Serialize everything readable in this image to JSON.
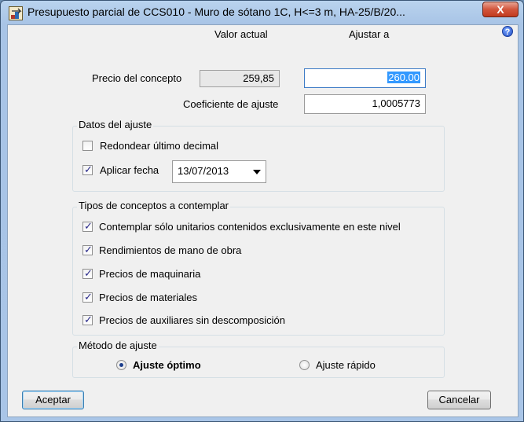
{
  "window": {
    "title": "Presupuesto parcial de CCS010 - Muro de sótano 1C, H<=3 m, HA-25/B/20...",
    "close_label": "X"
  },
  "prices": {
    "header_current": "Valor actual",
    "header_adjust": "Ajustar a",
    "concept_price_label": "Precio del concepto",
    "current_value": "259,85",
    "adjust_value": "260.00",
    "coefficient_label": "Coeficiente de ajuste",
    "coefficient_value": "1,0005773"
  },
  "adjust_data": {
    "legend": "Datos del ajuste",
    "round_label": "Redondear último decimal",
    "round_checked": false,
    "apply_date_label": "Aplicar fecha",
    "apply_date_checked": true,
    "date_value": "13/07/2013"
  },
  "concept_types": {
    "legend": "Tipos de conceptos a contemplar",
    "items": [
      {
        "label": "Contemplar sólo unitarios contenidos exclusivamente en este nivel",
        "checked": true
      },
      {
        "label": "Rendimientos de mano de obra",
        "checked": true
      },
      {
        "label": "Precios de maquinaria",
        "checked": true
      },
      {
        "label": "Precios de materiales",
        "checked": true
      },
      {
        "label": "Precios de auxiliares sin descomposición",
        "checked": true
      }
    ]
  },
  "method": {
    "legend": "Método de ajuste",
    "optimal_label": "Ajuste óptimo",
    "fast_label": "Ajuste rápido",
    "selected": "optimal"
  },
  "buttons": {
    "accept": "Aceptar",
    "cancel": "Cancelar"
  },
  "icons": {
    "app": "presupuesto-app-icon",
    "help": "help-icon",
    "dropdown": "chevron-down-icon"
  }
}
